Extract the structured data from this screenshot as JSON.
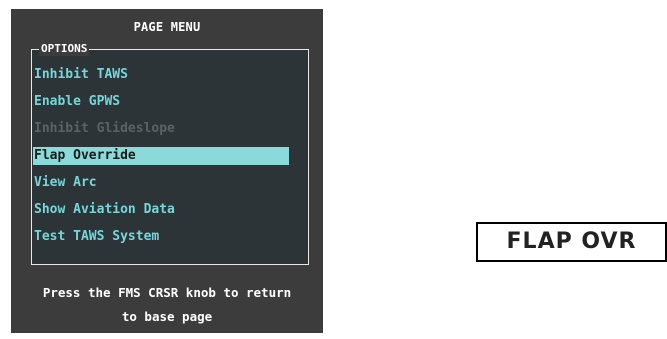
{
  "menu": {
    "title": "PAGE MENU",
    "options_label": "OPTIONS",
    "items": [
      {
        "label": "Inhibit TAWS",
        "state": "enabled"
      },
      {
        "label": "Enable GPWS",
        "state": "enabled"
      },
      {
        "label": "Inhibit Glideslope",
        "state": "disabled"
      },
      {
        "label": "Flap Override",
        "state": "selected"
      },
      {
        "label": "View Arc",
        "state": "enabled"
      },
      {
        "label": "Show Aviation Data",
        "state": "enabled"
      },
      {
        "label": "Test TAWS System",
        "state": "enabled"
      }
    ],
    "help_line1": "Press the FMS CRSR knob to return",
    "help_line2": "to base page"
  },
  "annunciator": {
    "text": "FLAP OVR"
  },
  "colors": {
    "panel_bg": "#3c3c3c",
    "item_text": "#76d6d8",
    "disabled_text": "#5a6266",
    "highlight": "#8adada"
  }
}
